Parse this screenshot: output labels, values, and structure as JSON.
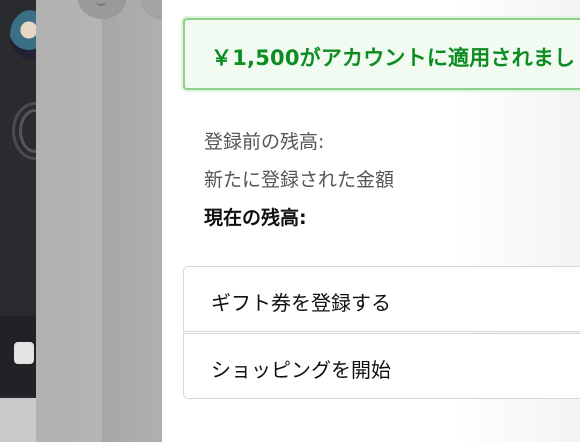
{
  "banner": {
    "text": "￥1,500がアカウントに適用されまし"
  },
  "balance": {
    "before_label": "登録前の残高:",
    "added_label": "新たに登録された金額",
    "current_label": "現在の残高:"
  },
  "actions": {
    "redeem_label": "ギフト券を登録する",
    "shop_label": "ショッピングを開始"
  },
  "colors": {
    "success_text": "#0d8c21",
    "success_border": "#8fd08f",
    "success_bg": "#f1fbf1"
  },
  "icons": {
    "avatar": "avatar",
    "ring": "ring-icon",
    "bottom_icon": "image-icon"
  }
}
